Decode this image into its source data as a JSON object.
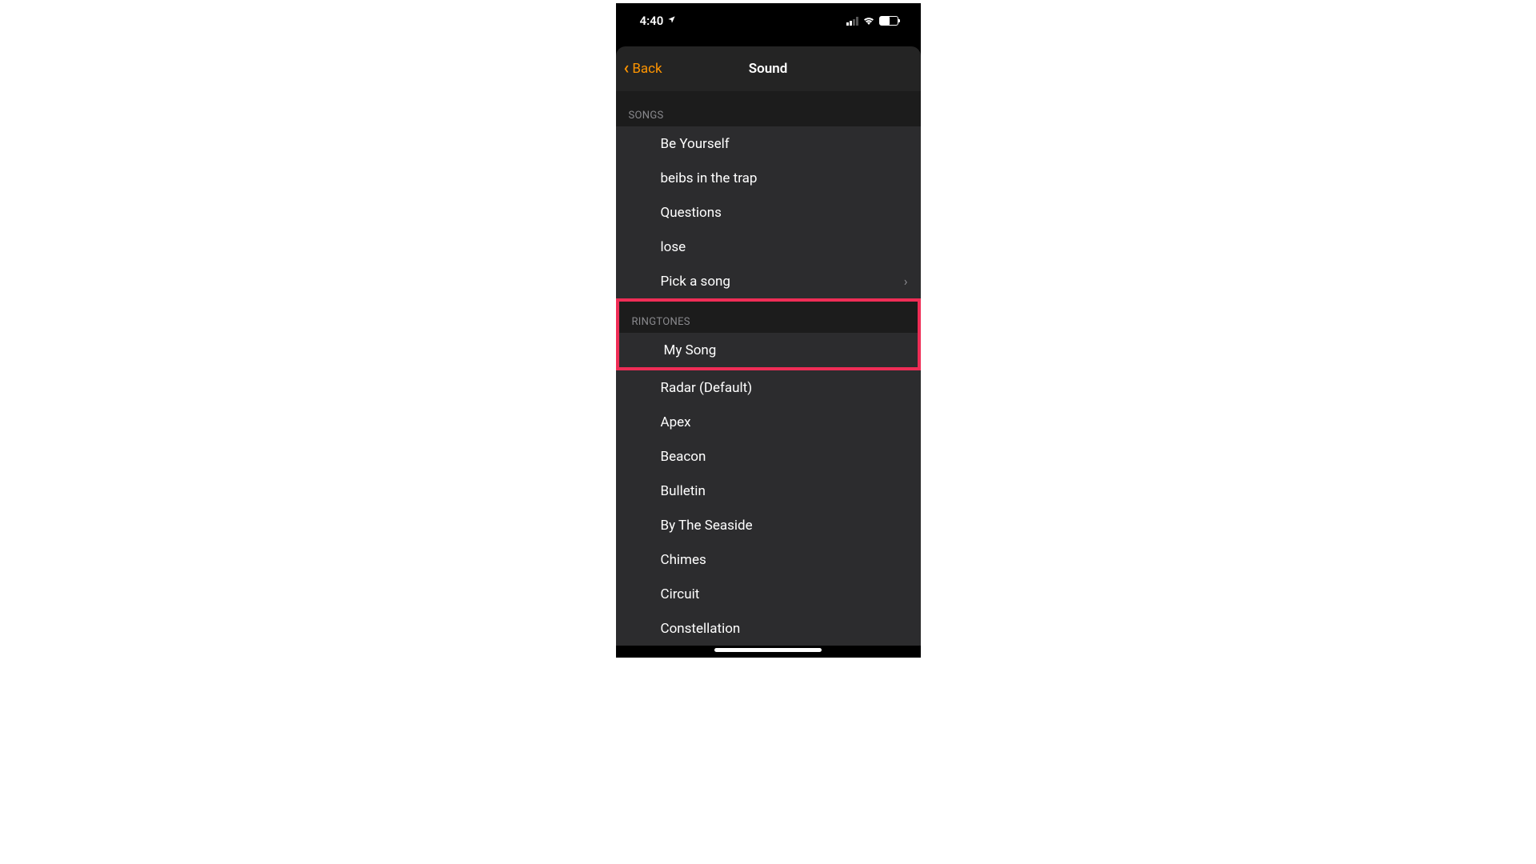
{
  "status_bar": {
    "time": "4:40"
  },
  "nav": {
    "back_label": "Back",
    "title": "Sound"
  },
  "sections": {
    "songs": {
      "header": "Songs",
      "items": [
        {
          "label": "Be Yourself"
        },
        {
          "label": "beibs in the trap"
        },
        {
          "label": "Questions"
        },
        {
          "label": "lose"
        },
        {
          "label": "Pick a song"
        }
      ]
    },
    "ringtones": {
      "header": "Ringtones",
      "highlighted_item": {
        "label": "My Song"
      },
      "items": [
        {
          "label": "Radar (Default)"
        },
        {
          "label": "Apex"
        },
        {
          "label": "Beacon"
        },
        {
          "label": "Bulletin"
        },
        {
          "label": "By The Seaside"
        },
        {
          "label": "Chimes"
        },
        {
          "label": "Circuit"
        },
        {
          "label": "Constellation"
        }
      ]
    }
  }
}
